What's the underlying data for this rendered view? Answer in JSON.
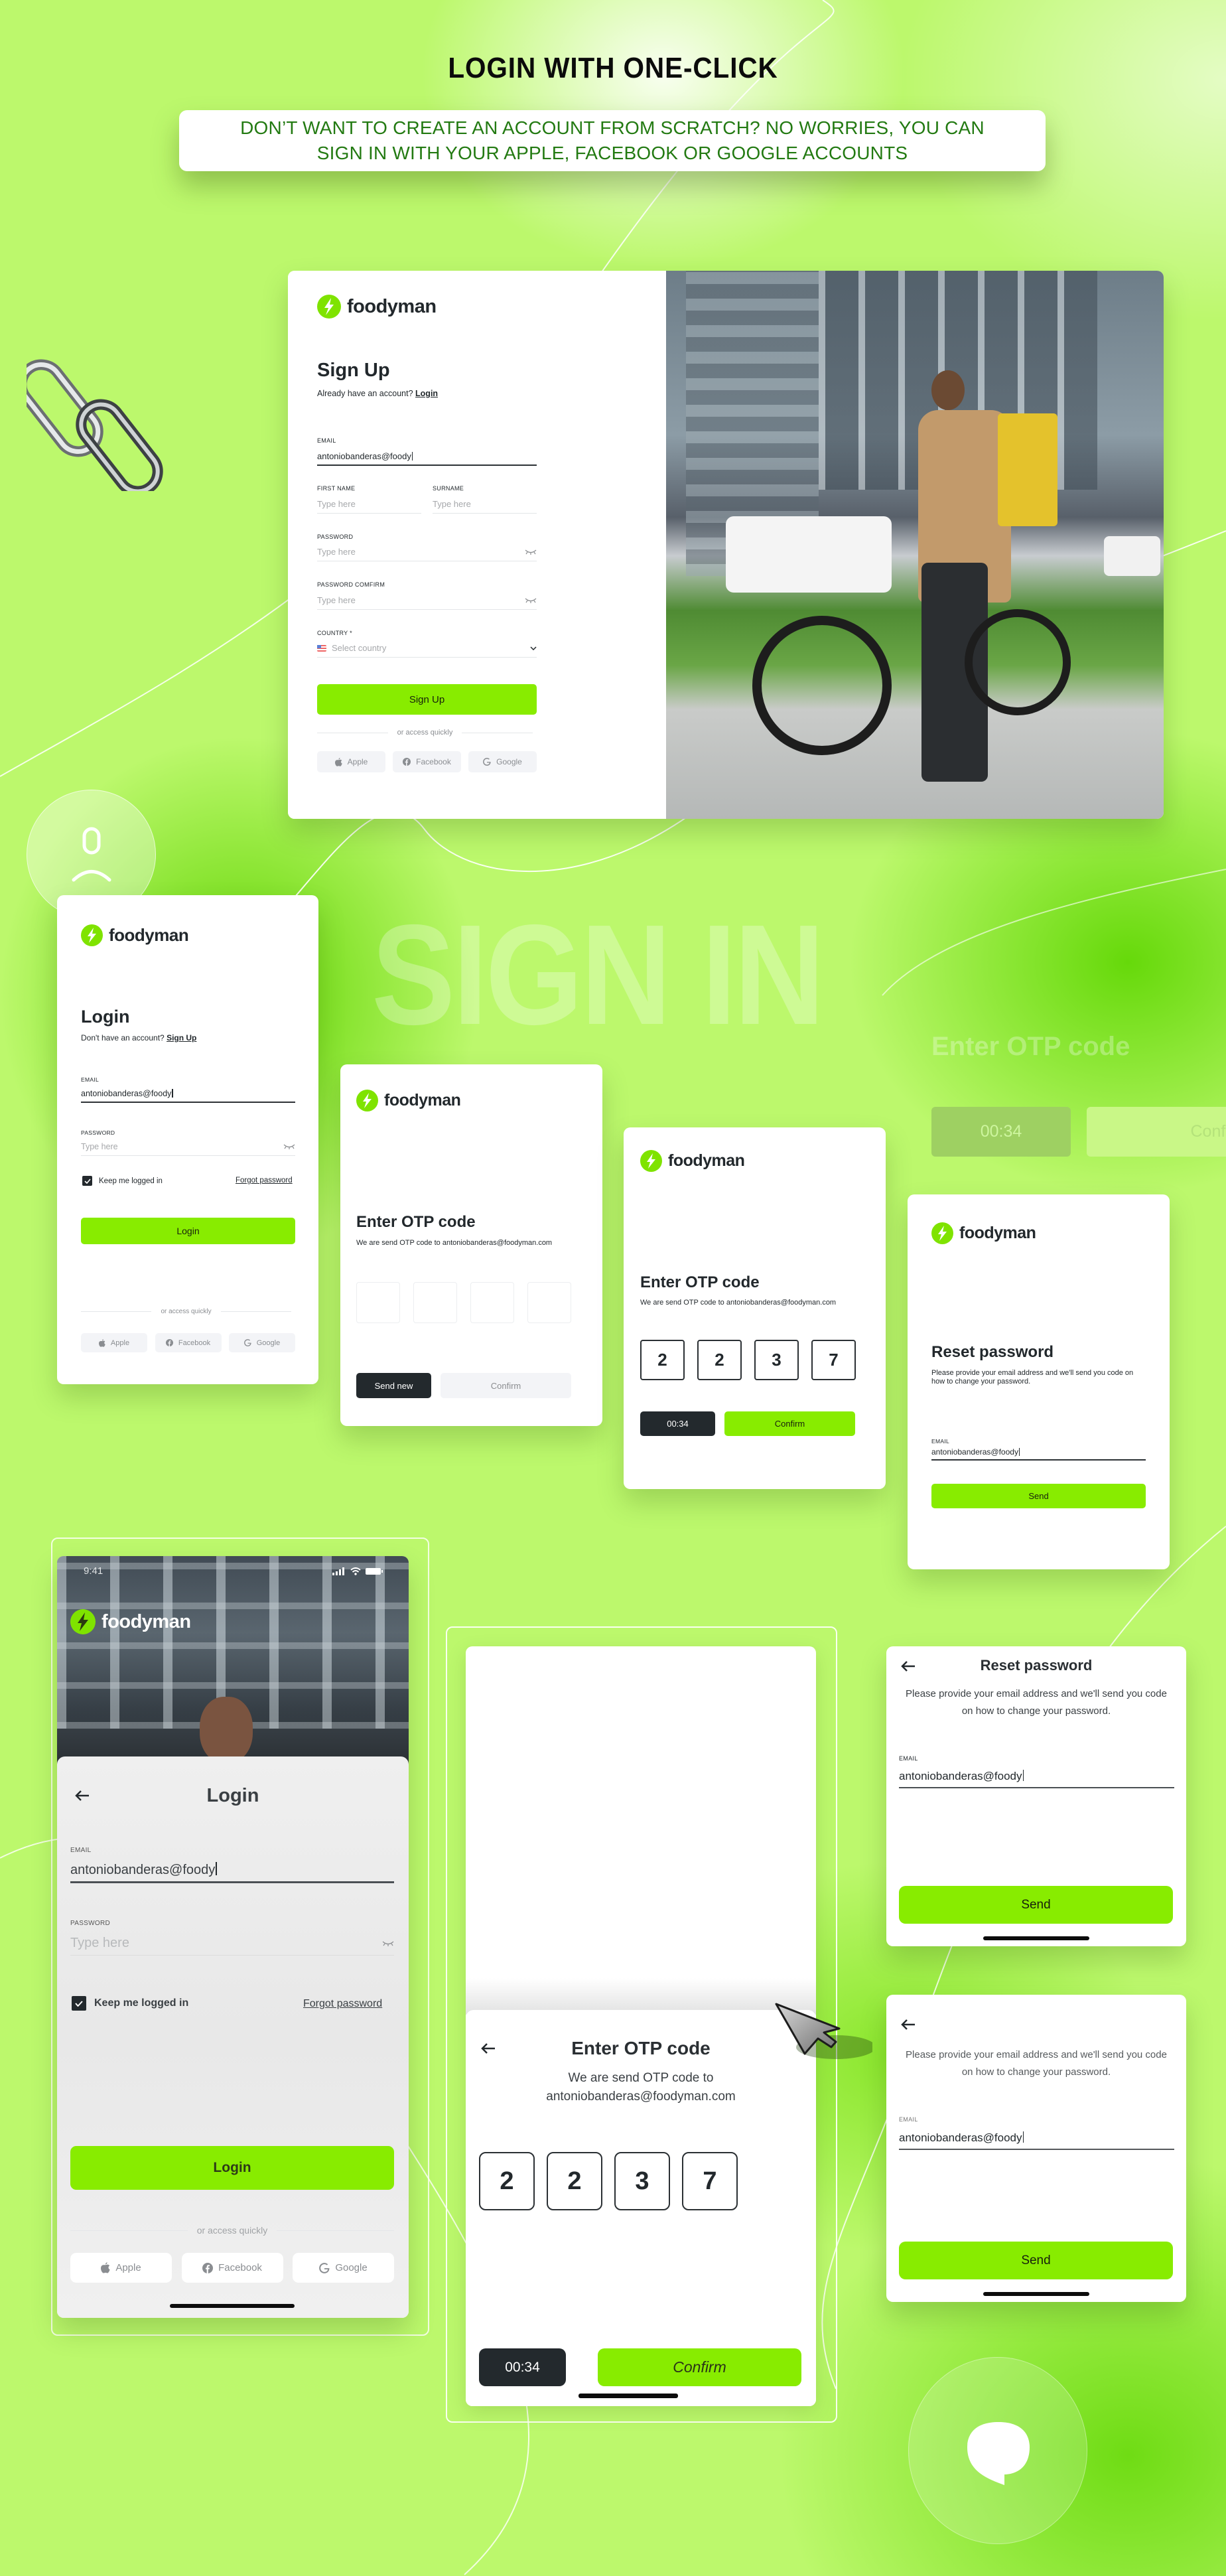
{
  "header": {
    "title": "LOGIN WITH ONE-CLICK",
    "subtitle": "DON’T WANT TO CREATE AN ACCOUNT FROM SCRATCH? NO WORRIES, YOU CAN SIGN IN WITH YOUR APPLE, FACEBOOK OR GOOGLE ACCOUNTS"
  },
  "brand": {
    "name": "foodyman",
    "accent": "#88ec00",
    "dark": "#23292d"
  },
  "background_text": {
    "sign_in": "SIGN IN",
    "otp_title": "Enter OTP code",
    "otp_timer": "00:34",
    "otp_confirm": "Confirm"
  },
  "signup_desktop": {
    "title": "Sign Up",
    "prompt": "Already have an account?",
    "prompt_link": "Login",
    "email_label": "EMAIL",
    "email_value": "antoniobanderas@foody",
    "first_name_label": "FIRST NAME",
    "first_name_placeholder": "Type here",
    "surname_label": "SURNAME",
    "surname_placeholder": "Type here",
    "password_label": "PASSWORD",
    "password_placeholder": "Type here",
    "password_confirm_label": "PASSWORD COMFIRM",
    "password_confirm_placeholder": "Type here",
    "country_label": "COUNTRY *",
    "country_placeholder": "Select country",
    "submit_label": "Sign Up",
    "divider": "or access quickly",
    "socials": [
      "Apple",
      "Facebook",
      "Google"
    ]
  },
  "login_desktop": {
    "title": "Login",
    "prompt": "Don't have an account?",
    "prompt_link": "Sign Up",
    "email_label": "EMAIL",
    "email_value": "antoniobanderas@foody",
    "password_label": "PASSWORD",
    "password_placeholder": "Type here",
    "keep_logged_in": "Keep me logged in",
    "keep_logged_in_checked": true,
    "forgot_password": "Forgot password",
    "submit_label": "Login",
    "divider": "or access quickly",
    "socials": [
      "Apple",
      "Facebook",
      "Google"
    ]
  },
  "otp_empty_desktop": {
    "title": "Enter OTP code",
    "message": "We are send OTP code to antoniobanderas@foodyman.com",
    "digits": [
      "",
      "",
      "",
      ""
    ],
    "send_new_label": "Send new",
    "confirm_label": "Confirm"
  },
  "otp_filled_desktop": {
    "title": "Enter OTP code",
    "message": "We are send OTP code to antoniobanderas@foodyman.com",
    "digits": [
      "2",
      "2",
      "3",
      "7"
    ],
    "timer": "00:34",
    "confirm_label": "Confirm"
  },
  "reset_desktop": {
    "title": "Reset password",
    "message": "Please provide your email address and we'll send you code on how to change your password.",
    "email_label": "EMAIL",
    "email_value": "antoniobanderas@foody",
    "send_label": "Send"
  },
  "login_mobile": {
    "status_time": "9:41",
    "title": "Login",
    "email_label": "EMAIL",
    "email_value": "antoniobanderas@foody",
    "password_label": "PASSWORD",
    "password_placeholder": "Type here",
    "keep_logged_in": "Keep me logged in",
    "keep_logged_in_checked": true,
    "forgot_password": "Forgot password",
    "submit_label": "Login",
    "divider": "or access quickly",
    "socials": [
      "Apple",
      "Facebook",
      "Google"
    ]
  },
  "otp_mobile": {
    "title": "Enter OTP code",
    "message_line1": "We are send OTP code to",
    "message_line2": "antoniobanderas@foodyman.com",
    "digits": [
      "2",
      "2",
      "3",
      "7"
    ],
    "timer": "00:34",
    "confirm_label": "Confirm"
  },
  "reset_mobile": {
    "title": "Reset password",
    "message": "Please provide your email address and we'll send you code on how to change your password.",
    "email_label": "EMAIL",
    "email_value": "antoniobanderas@foody",
    "send_label": "Send"
  },
  "reset_mobile_2": {
    "message": "Please provide your email address and we'll send you code on how to change your password.",
    "email_label": "EMAIL",
    "email_value": "antoniobanderas@foody",
    "send_label": "Send"
  }
}
